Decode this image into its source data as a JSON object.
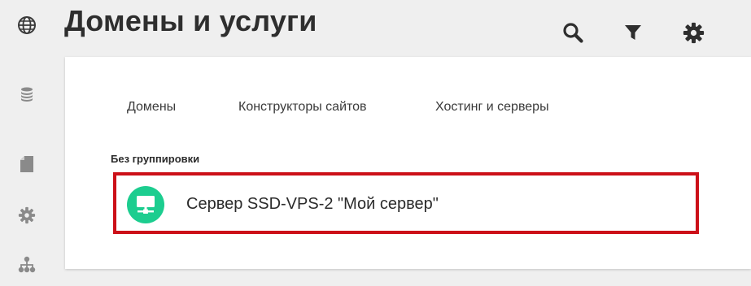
{
  "header": {
    "title": "Домены и услуги"
  },
  "sidebar": {
    "items": [
      {
        "icon": "globe-icon"
      },
      {
        "icon": "coins-icon"
      },
      {
        "icon": "document-icon"
      },
      {
        "icon": "gear-icon"
      },
      {
        "icon": "sitemap-icon"
      }
    ]
  },
  "toolbar": {
    "icons": [
      "search-icon",
      "filter-icon",
      "gear-icon"
    ]
  },
  "tabs": [
    {
      "label": "Домены"
    },
    {
      "label": "Конструкторы сайтов"
    },
    {
      "label": "Хостинг и серверы"
    }
  ],
  "group": {
    "label": "Без группировки"
  },
  "server": {
    "name": "Сервер SSD-VPS-2 \"Мой сервер\"",
    "icon": "monitor-network-icon",
    "icon_color": "#1ccd8f",
    "highlight_color": "#cc1018"
  }
}
